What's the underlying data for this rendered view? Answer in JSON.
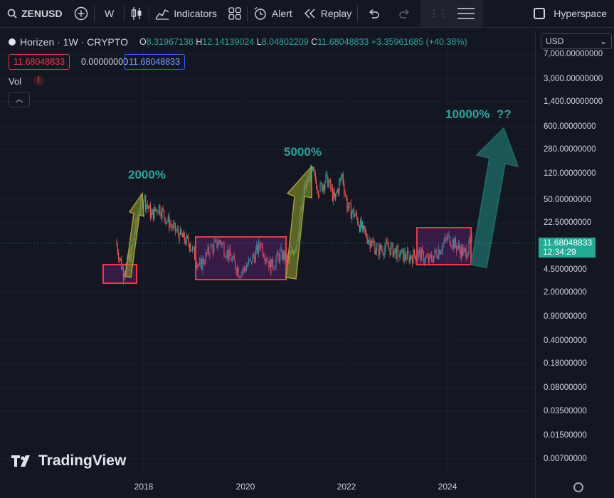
{
  "toolbar": {
    "symbol": "ZENUSD",
    "interval": "W",
    "indicators_label": "Indicators",
    "alert_label": "Alert",
    "replay_label": "Replay",
    "hyperspace_label": "Hyperspace"
  },
  "legend": {
    "title": "Horizen · 1W · CRYPTO",
    "open_label": "O",
    "open": "8.31967136",
    "high_label": "H",
    "high": "12.14139024",
    "low_label": "L",
    "low": "8.04802209",
    "close_label": "C",
    "close": "11.68048833",
    "change": "+3.35961685 (+40.38%)",
    "price_sell": "11.68048833",
    "price_spread": "0.00000000",
    "price_buy": "11.68048833",
    "volume_label": "Vol",
    "volume_warning": "!"
  },
  "price_axis": {
    "currency": "USD",
    "ticks": [
      "7,000.00000000",
      "3,000.00000000",
      "1,400.00000000",
      "600.00000000",
      "280.00000000",
      "120.00000000",
      "50.00000000",
      "22.50000000",
      "4.50000000",
      "2.00000000",
      "0.90000000",
      "0.40000000",
      "0.18000000",
      "0.08000000",
      "0.03500000",
      "0.01500000",
      "0.00700000"
    ],
    "last_price": "11.68048833",
    "countdown": "12:34:29",
    "last_price_color": "#22ab94"
  },
  "time_axis": {
    "ticks": [
      "2018",
      "2020",
      "2022",
      "2024"
    ]
  },
  "annotations": {
    "label_1": "2000%",
    "label_2": "5000%",
    "label_3": "10000%  ??",
    "annotation_color": "#26a69a",
    "box_color": "#f23645"
  },
  "chart_data": {
    "type": "candlestick",
    "title": "Horizen · 1W · CRYPTO",
    "x_ticks": [
      "2018",
      "2020",
      "2022",
      "2024"
    ],
    "y_scale": "log",
    "ylim": [
      0.006,
      9000
    ],
    "series": [
      {
        "x": [
          2017.45,
          2017.6,
          2017.75,
          2017.9,
          2018.0,
          2018.15,
          2018.3,
          2018.5,
          2018.7,
          2018.9,
          2019.1,
          2019.3,
          2019.5,
          2019.7,
          2019.9,
          2020.1,
          2020.3,
          2020.5,
          2020.7,
          2020.85,
          2021.0,
          2021.15,
          2021.3,
          2021.45,
          2021.6,
          2021.75,
          2021.9,
          2022.0,
          2022.15,
          2022.3,
          2022.45,
          2022.6,
          2022.8,
          2023.0,
          2023.2,
          2023.4,
          2023.6,
          2023.8,
          2024.0,
          2024.15,
          2024.3,
          2024.45
        ],
        "close": [
          12,
          4,
          8,
          35,
          55,
          30,
          40,
          22,
          15,
          11,
          5,
          9,
          12,
          7,
          4,
          6,
          11,
          5,
          8,
          6,
          12,
          70,
          140,
          70,
          110,
          50,
          120,
          40,
          30,
          18,
          12,
          9,
          10,
          8,
          7,
          8,
          6,
          9,
          14,
          10,
          8,
          11.68
        ]
      }
    ],
    "grid": true,
    "legend": "top-left"
  },
  "branding": {
    "logo_text": "TradingView"
  }
}
